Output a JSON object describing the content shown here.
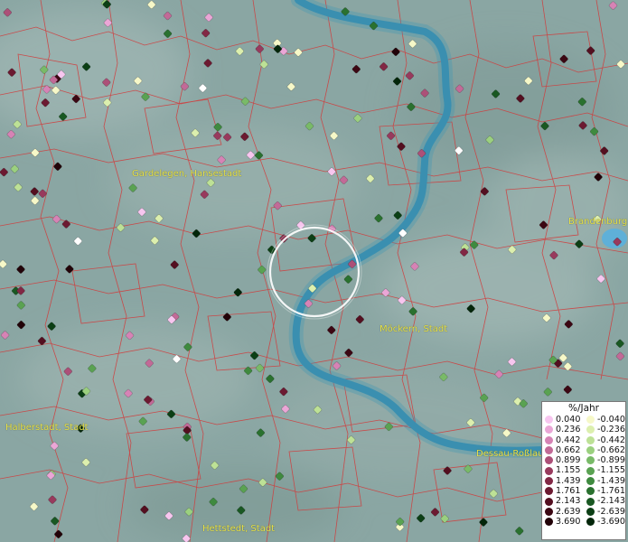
{
  "map": {
    "places": [
      {
        "label": "Gardelegen, Hansestadt"
      },
      {
        "label": "Brandenburg"
      },
      {
        "label": "Möckern, Stadt"
      },
      {
        "label": "Halberstadt, Stadt"
      },
      {
        "label": "Dessau-Roßlau"
      },
      {
        "label": "Hettstedt, Stadt"
      }
    ],
    "colors": {
      "terrain": "#8aa6a3",
      "river": "#3f97b4",
      "boundary": "#d23a3a",
      "focus_circle": "#ffffff",
      "label": "#e8e24a"
    }
  },
  "legend": {
    "title": "%/Jahr",
    "positive": [
      {
        "value": "0.040",
        "color": "#f7c6ef"
      },
      {
        "value": "0.236",
        "color": "#eaa6d6"
      },
      {
        "value": "0.442",
        "color": "#d683b5"
      },
      {
        "value": "0.662",
        "color": "#c26a97"
      },
      {
        "value": "0.899",
        "color": "#ac5078"
      },
      {
        "value": "1.155",
        "color": "#983a5d"
      },
      {
        "value": "1.439",
        "color": "#822845"
      },
      {
        "value": "1.761",
        "color": "#6c1a31"
      },
      {
        "value": "2.143",
        "color": "#540f20"
      },
      {
        "value": "2.639",
        "color": "#3c0713"
      },
      {
        "value": "3.690",
        "color": "#220208"
      }
    ],
    "negative": [
      {
        "value": "-0.040",
        "color": "#f6f8c8"
      },
      {
        "value": "-0.236",
        "color": "#dcefae"
      },
      {
        "value": "-0.442",
        "color": "#bde196"
      },
      {
        "value": "-0.662",
        "color": "#9bd07f"
      },
      {
        "value": "-0.899",
        "color": "#79ba68"
      },
      {
        "value": "-1.155",
        "color": "#5aa252"
      },
      {
        "value": "-1.439",
        "color": "#3f8a3f"
      },
      {
        "value": "-1.761",
        "color": "#2a712f"
      },
      {
        "value": "-2.143",
        "color": "#195822"
      },
      {
        "value": "-2.639",
        "color": "#0c3f15"
      },
      {
        "value": "-3.690",
        "color": "#03260a"
      }
    ]
  }
}
